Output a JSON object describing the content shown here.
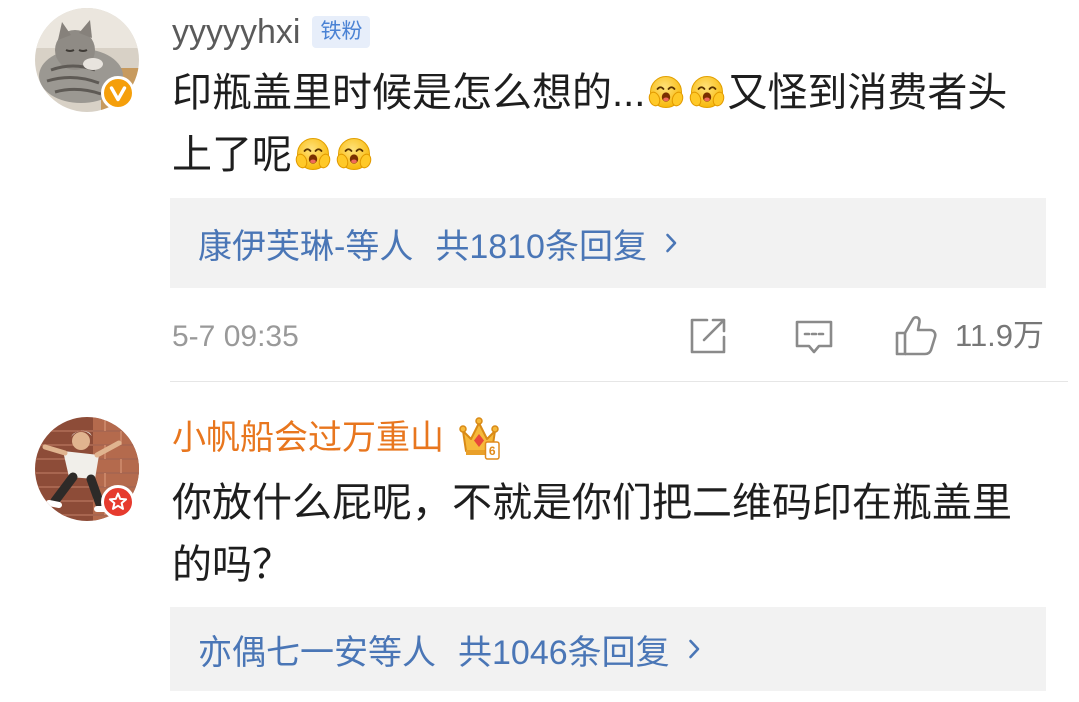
{
  "comments": [
    {
      "username": "yyyyyhxi",
      "fan_badge": "铁粉",
      "avatar_badge_icon": "verified-v-icon",
      "content": [
        "印瓶盖里时候是怎么想的...",
        "又怪到消费者头上了呢"
      ],
      "emoji_icon": "hands-on-cheeks-emoji",
      "replies": {
        "names": "康伊芙琳-等人",
        "total": "共1810条回复"
      },
      "timestamp": "5-7 09:35",
      "likes": "11.9万"
    },
    {
      "username": "小帆船会过万重山",
      "crown_badge_level": "6",
      "avatar_badge_icon": "red-star-icon",
      "content": [
        "你放什么屁呢，不就是你们把二维码印在瓶盖里的吗？"
      ],
      "replies": {
        "names": "亦偶七一安等人",
        "total": "共1046条回复"
      }
    }
  ],
  "icons": {
    "share": "share-icon",
    "comment": "comment-icon",
    "like": "thumbs-up-icon",
    "reply_arrow": "chevron-right-icon",
    "member_crown": "crown-icon"
  },
  "colors": {
    "text": "#1e1e1e",
    "username_default": "#5a5a5a",
    "username_vip": "#e8761e",
    "fan_badge_bg": "#e7eefa",
    "fan_badge_text": "#4a82d4",
    "reply_link": "#4a76b6",
    "reply_bg": "#f2f2f2",
    "meta": "#999999",
    "like_count": "#777777",
    "icon": "#8a8a8a",
    "verified_badge": "#f59f0b",
    "star_badge": "#e63b2e"
  }
}
